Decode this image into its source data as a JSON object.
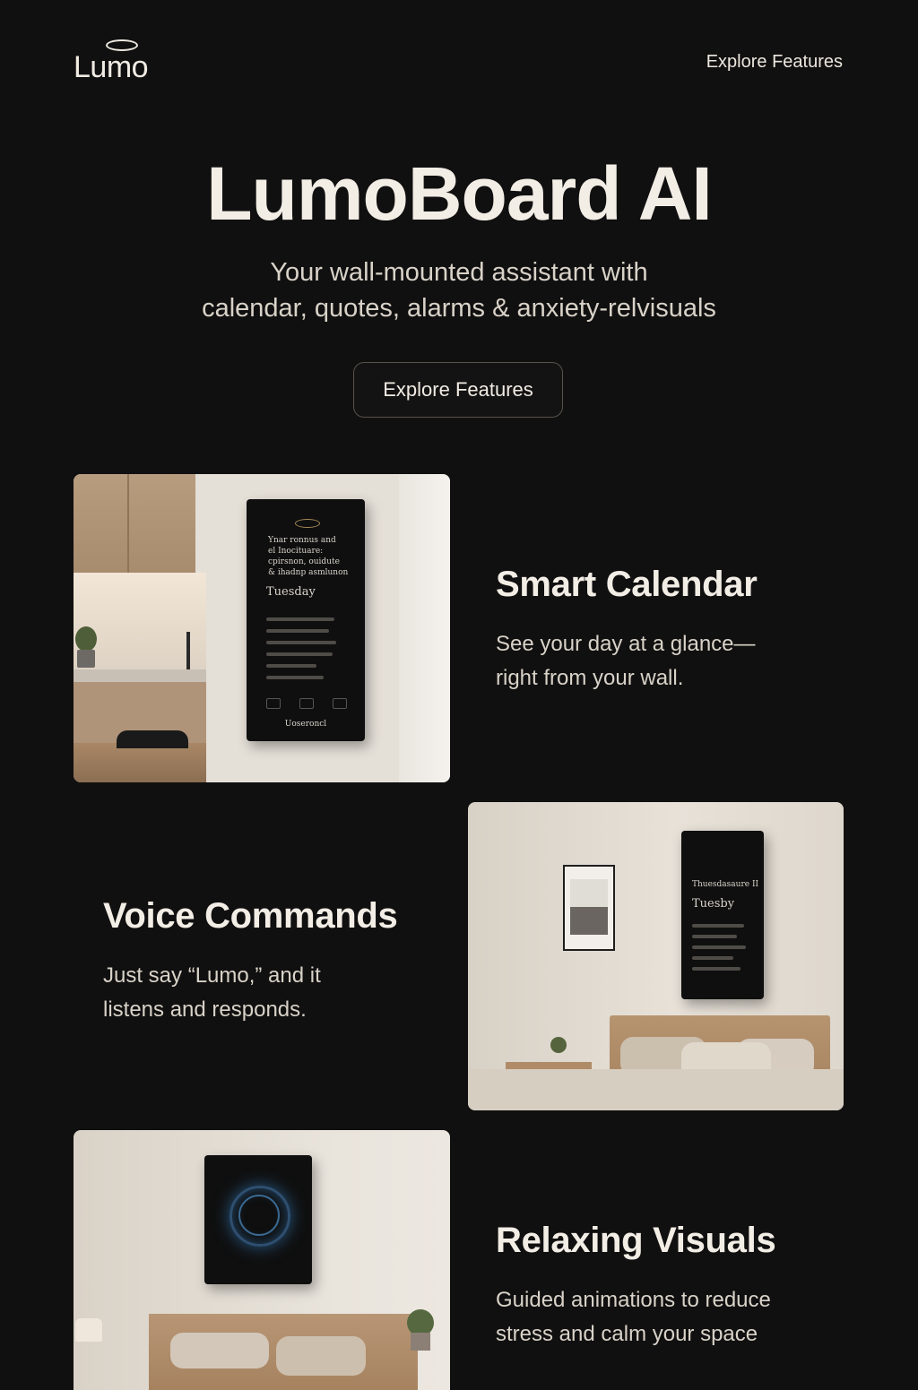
{
  "header": {
    "logo_text": "Lumo",
    "nav_link": "Explore Features"
  },
  "hero": {
    "title": "LumoBoard AI",
    "subtitle_line1": "Your wall-mounted assistant with",
    "subtitle_line2": "calendar, quotes, alarms & anxiety-relvisuals",
    "cta_label": "Explore Features"
  },
  "features": [
    {
      "title": "Smart Calendar",
      "description": "See your day at a glance— right from your wall.",
      "device_text": [
        "Ynar ronnus and",
        "el Inocituare:",
        "cpirsnon, ouidute",
        "& ihadnp asmlunon"
      ],
      "device_day": "Tuesday",
      "device_footer": "Uoseroncl"
    },
    {
      "title": "Voice Commands",
      "description": "Just say “Lumo,” and it listens and responds.",
      "device_text": [
        "Thuesdasaure II"
      ],
      "device_day": "Tuesby"
    },
    {
      "title": "Relaxing Visuals",
      "description": "Guided animations to reduce stress and calm your space"
    }
  ]
}
